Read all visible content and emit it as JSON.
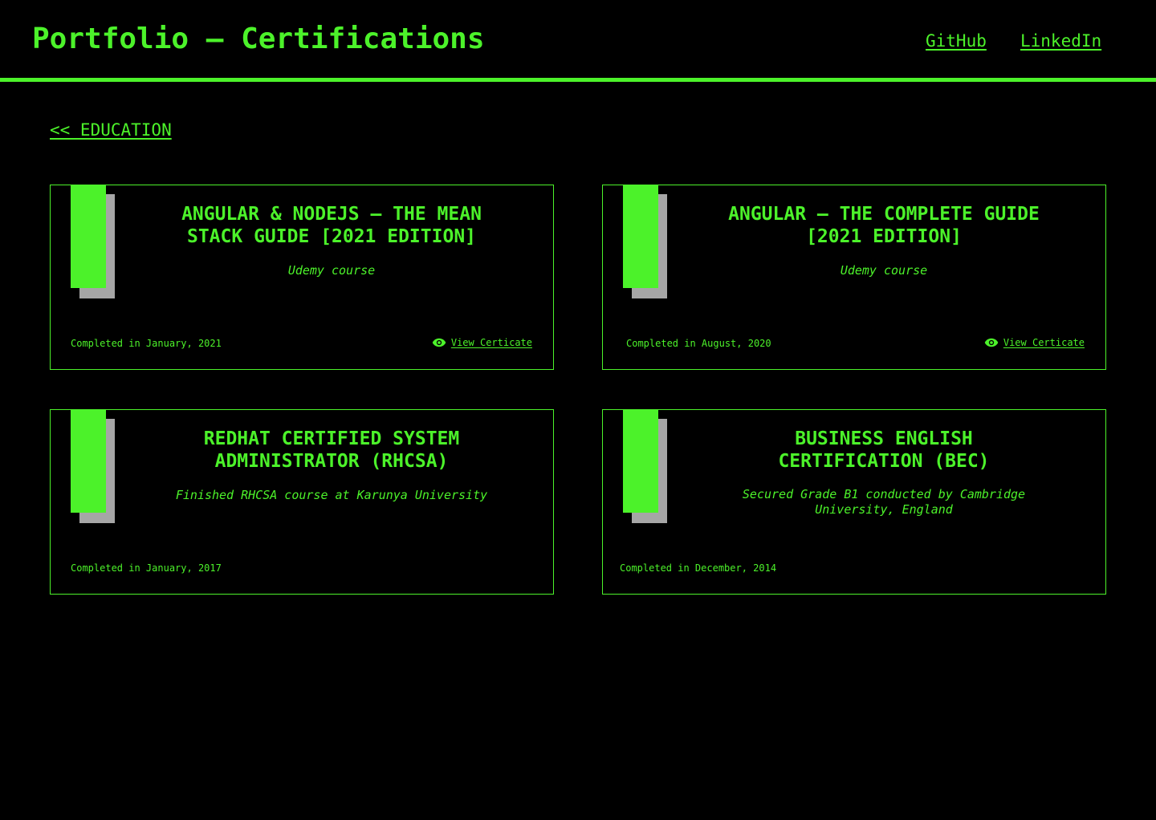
{
  "header": {
    "title": "Portfolio – Certifications",
    "links": [
      {
        "label": "GitHub"
      },
      {
        "label": "LinkedIn"
      }
    ]
  },
  "back_link": {
    "label": "<< EDUCATION"
  },
  "colors": {
    "accent": "#4cf22a",
    "background": "#000000",
    "shadow": "#a6a6a6"
  },
  "certifications": [
    {
      "title": "ANGULAR & NODEJS – THE MEAN STACK GUIDE [2021 EDITION]",
      "subtitle": "Udemy course",
      "completed": "Completed in January, 2021",
      "view_label": "View Certicate",
      "view_icon": "eye-icon"
    },
    {
      "title": "ANGULAR – THE COMPLETE GUIDE [2021 EDITION]",
      "subtitle": "Udemy course",
      "completed": "Completed in August, 2020",
      "view_label": "View Certicate",
      "view_icon": "eye-icon"
    },
    {
      "title": "REDHAT CERTIFIED SYSTEM ADMINISTRATOR (RHCSA)",
      "subtitle": "Finished RHCSA course at Karunya University",
      "completed": "Completed in January, 2017"
    },
    {
      "title": "BUSINESS ENGLISH CERTIFICATION (BEC)",
      "subtitle": "Secured Grade B1 conducted by Cambridge University, England",
      "completed": "Completed in December, 2014"
    }
  ]
}
